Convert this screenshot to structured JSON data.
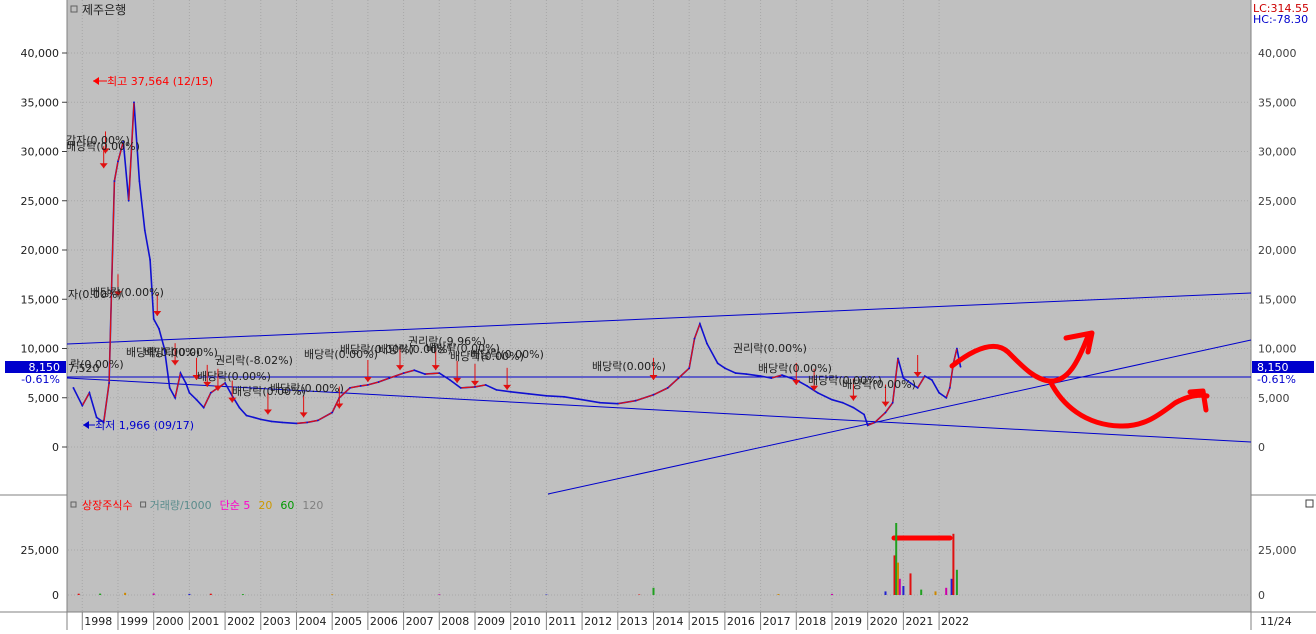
{
  "chart_data": [
    {
      "type": "line",
      "title": "제주은행",
      "header_right": [
        "LC:314.55",
        "HC:-78.30"
      ],
      "ylim": [
        0,
        45000
      ],
      "yticks": [
        0,
        5000,
        10000,
        15000,
        20000,
        25000,
        30000,
        35000,
        40000
      ],
      "ytick_labels": [
        "0",
        "5,000",
        "10,000",
        "15,000",
        "20,000",
        "25,000",
        "30,000",
        "35,000",
        "40,000"
      ],
      "xticks": [
        "1998",
        "1999",
        "2000",
        "2001",
        "2002",
        "2003",
        "2004",
        "2005",
        "2006",
        "2007",
        "2008",
        "2009",
        "2010",
        "2011",
        "2012",
        "2013",
        "2014",
        "2015",
        "2016",
        "2017",
        "2018",
        "2019",
        "2020",
        "2021",
        "2022"
      ],
      "last_price_label": "8,150",
      "last_change_label": "-0.61%",
      "left_value_label": "7,520",
      "annotations": {
        "high": "최고 37,564 (12/15)",
        "low": "최저 1,966 (09/17)"
      },
      "event_labels": [
        "감자(0.00%)",
        "배당락(0.00%)",
        "자(0.00%)",
        "배당락(0.00%)",
        "락(0.00%)",
        "배당락(0.00%)",
        "배당락(0.00%)",
        "권리락(-8.02%)",
        "배당락(0.00%)",
        "배당락(0.00%)",
        "배당락(0.00%)",
        "배당락(0.00%)",
        "배당락(0.00%)",
        "배당락(0.00%)",
        "권리락(-9.96%)",
        "배당락(0.00%)",
        "배당락(0.00%)",
        "배당락(0.00%)",
        "배당락(0.00%)",
        "권리락(0.00%)",
        "배당락(0.00%)",
        "배당락(0.00%)",
        "배당락(0.00%)"
      ],
      "series": [
        {
          "name": "",
          "x": [
            1997.75,
            1998.0,
            1998.2,
            1998.4,
            1998.6,
            1998.75,
            1998.9,
            1999.0,
            1999.15,
            1999.3,
            1999.45,
            1999.6,
            1999.75,
            1999.9,
            2000.0,
            2000.15,
            2000.3,
            2000.45,
            2000.6,
            2000.75,
            2000.9,
            2001.0,
            2001.2,
            2001.4,
            2001.6,
            2001.8,
            2002.0,
            2002.2,
            2002.4,
            2002.6,
            2002.8,
            2003.0,
            2003.3,
            2003.6,
            2004.0,
            2004.3,
            2004.6,
            2005.0,
            2005.2,
            2005.5,
            2005.8,
            2006.0,
            2006.3,
            2006.6,
            2007.0,
            2007.3,
            2007.6,
            2008.0,
            2008.3,
            2008.6,
            2009.0,
            2009.3,
            2009.6,
            2010.0,
            2010.5,
            2011.0,
            2011.5,
            2012.0,
            2012.5,
            2013.0,
            2013.5,
            2014.0,
            2014.4,
            2014.7,
            2015.0,
            2015.15,
            2015.3,
            2015.5,
            2015.8,
            2016.0,
            2016.3,
            2016.6,
            2017.0,
            2017.3,
            2017.6,
            2018.0,
            2018.3,
            2018.6,
            2019.0,
            2019.3,
            2019.6,
            2019.9,
            2020.0,
            2020.2,
            2020.5,
            2020.7,
            2020.85,
            2021.0,
            2021.2,
            2021.4,
            2021.6,
            2021.8,
            2022.0,
            2022.2,
            2022.3,
            2022.4,
            2022.5,
            2022.6
          ],
          "y": [
            6000,
            4200,
            5500,
            3000,
            2500,
            6500,
            27000,
            29000,
            31000,
            25000,
            35000,
            27000,
            22000,
            19000,
            13000,
            12000,
            10000,
            6000,
            5000,
            7500,
            6500,
            5500,
            4800,
            4000,
            5500,
            6000,
            6500,
            5200,
            4000,
            3200,
            3000,
            2800,
            2600,
            2500,
            2400,
            2500,
            2700,
            3500,
            5000,
            6000,
            6200,
            6300,
            6600,
            7000,
            7500,
            7800,
            7400,
            7500,
            6800,
            6000,
            6100,
            6300,
            5800,
            5600,
            5400,
            5200,
            5100,
            4800,
            4500,
            4400,
            4700,
            5300,
            6000,
            7000,
            8000,
            11000,
            12500,
            10500,
            8500,
            8000,
            7500,
            7400,
            7200,
            7000,
            7300,
            6800,
            6200,
            5500,
            4800,
            4500,
            4000,
            3300,
            2200,
            2500,
            3500,
            4500,
            9000,
            7000,
            6500,
            6000,
            7200,
            6800,
            5500,
            5000,
            6000,
            8500,
            10000,
            8150
          ]
        }
      ]
    },
    {
      "type": "bar",
      "legend": [
        "상장주식수",
        "거래량/1000",
        "단순 5",
        "20",
        "60",
        "120"
      ],
      "legend_colors": [
        "#ff0000",
        "#5a8c8c",
        "#ff00cc",
        "#cc9900",
        "#009900",
        "#808080"
      ],
      "ylim": [
        0,
        45000
      ],
      "yticks": [
        0,
        25000
      ],
      "ytick_labels": [
        "0",
        "25,000"
      ],
      "x_end_label": "11/24",
      "spikes": {
        "x": [
          1997.9,
          1998.5,
          1999.2,
          2000.0,
          2001.0,
          2001.6,
          2002.5,
          2005.0,
          2008.0,
          2011.0,
          2013.6,
          2014.0,
          2017.5,
          2019.0,
          2020.5,
          2020.75,
          2020.8,
          2020.85,
          2020.9,
          2021.0,
          2021.2,
          2021.5,
          2021.9,
          2022.2,
          2022.35,
          2022.4,
          2022.5
        ],
        "y": [
          700,
          800,
          1200,
          900,
          600,
          700,
          500,
          400,
          400,
          300,
          300,
          4000,
          500,
          600,
          2000,
          22000,
          40000,
          18000,
          9000,
          5000,
          12000,
          3000,
          2000,
          4000,
          9000,
          34000,
          14000
        ]
      }
    }
  ]
}
